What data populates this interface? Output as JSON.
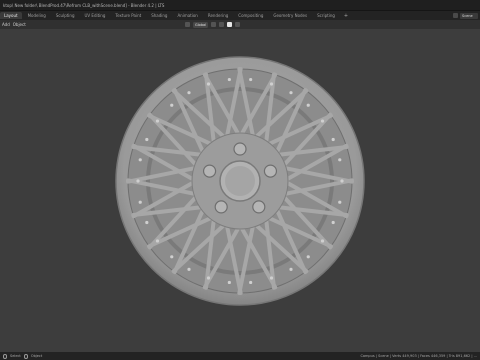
{
  "window": {
    "title": "ktop\\ New folder\\ BlendProd.47\\Refrom CLB_withScene.blend] - Blender 4.2 | LTS"
  },
  "workspaces": {
    "tabs": [
      {
        "label": "Layout",
        "active": true
      },
      {
        "label": "Modeling"
      },
      {
        "label": "Sculpting"
      },
      {
        "label": "UV Editing"
      },
      {
        "label": "Texture Paint"
      },
      {
        "label": "Shading"
      },
      {
        "label": "Animation"
      },
      {
        "label": "Rendering"
      },
      {
        "label": "Compositing"
      },
      {
        "label": "Geometry Nodes"
      },
      {
        "label": "Scripting"
      }
    ],
    "add_label": "+",
    "scene_label": "Scene"
  },
  "header": {
    "menu": [
      "Add",
      "Object"
    ],
    "orientation": "Global"
  },
  "status": {
    "left_label": "Select",
    "right_label": "Object",
    "stats": "Campus | Scene | Verts 449,903 | Faces 446,359 | Tris 891,662 | ..."
  },
  "colors": {
    "accent": "#4772b3",
    "viewport_bg": "#3d3d3d",
    "wheel": "#9e9e9e"
  },
  "icons": {
    "mouse": "mouse-icon",
    "hub": "wheel-hub-icon"
  }
}
